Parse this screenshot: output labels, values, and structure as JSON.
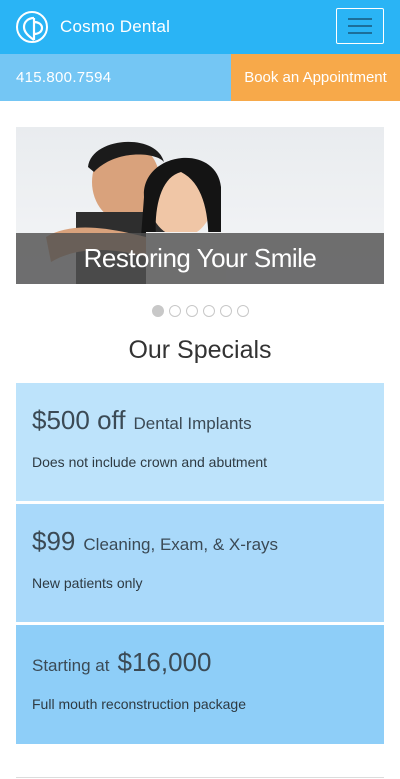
{
  "header": {
    "brand": "Cosmo Dental",
    "logo_icon": "tooth-logo-icon",
    "menu_icon": "hamburger-menu-icon",
    "color": "#2ab4f5"
  },
  "cta": {
    "phone": "415.800.7594",
    "book_label": "Book an Appointment",
    "phone_bg": "#74c6f4",
    "book_bg": "#f7a94a"
  },
  "hero": {
    "caption": "Restoring Your Smile",
    "slides_count": 6,
    "active_slide": 1
  },
  "specials": {
    "title": "Our Specials",
    "items": [
      {
        "big": "$500 off",
        "small": "Dental Implants",
        "desc": "Does not include crown and abutment"
      },
      {
        "big": "$99",
        "small": "Cleaning, Exam, & X-rays",
        "desc": "New patients only"
      },
      {
        "prefix": "Starting at",
        "big": "$16,000",
        "desc": "Full mouth reconstruction package"
      }
    ]
  }
}
